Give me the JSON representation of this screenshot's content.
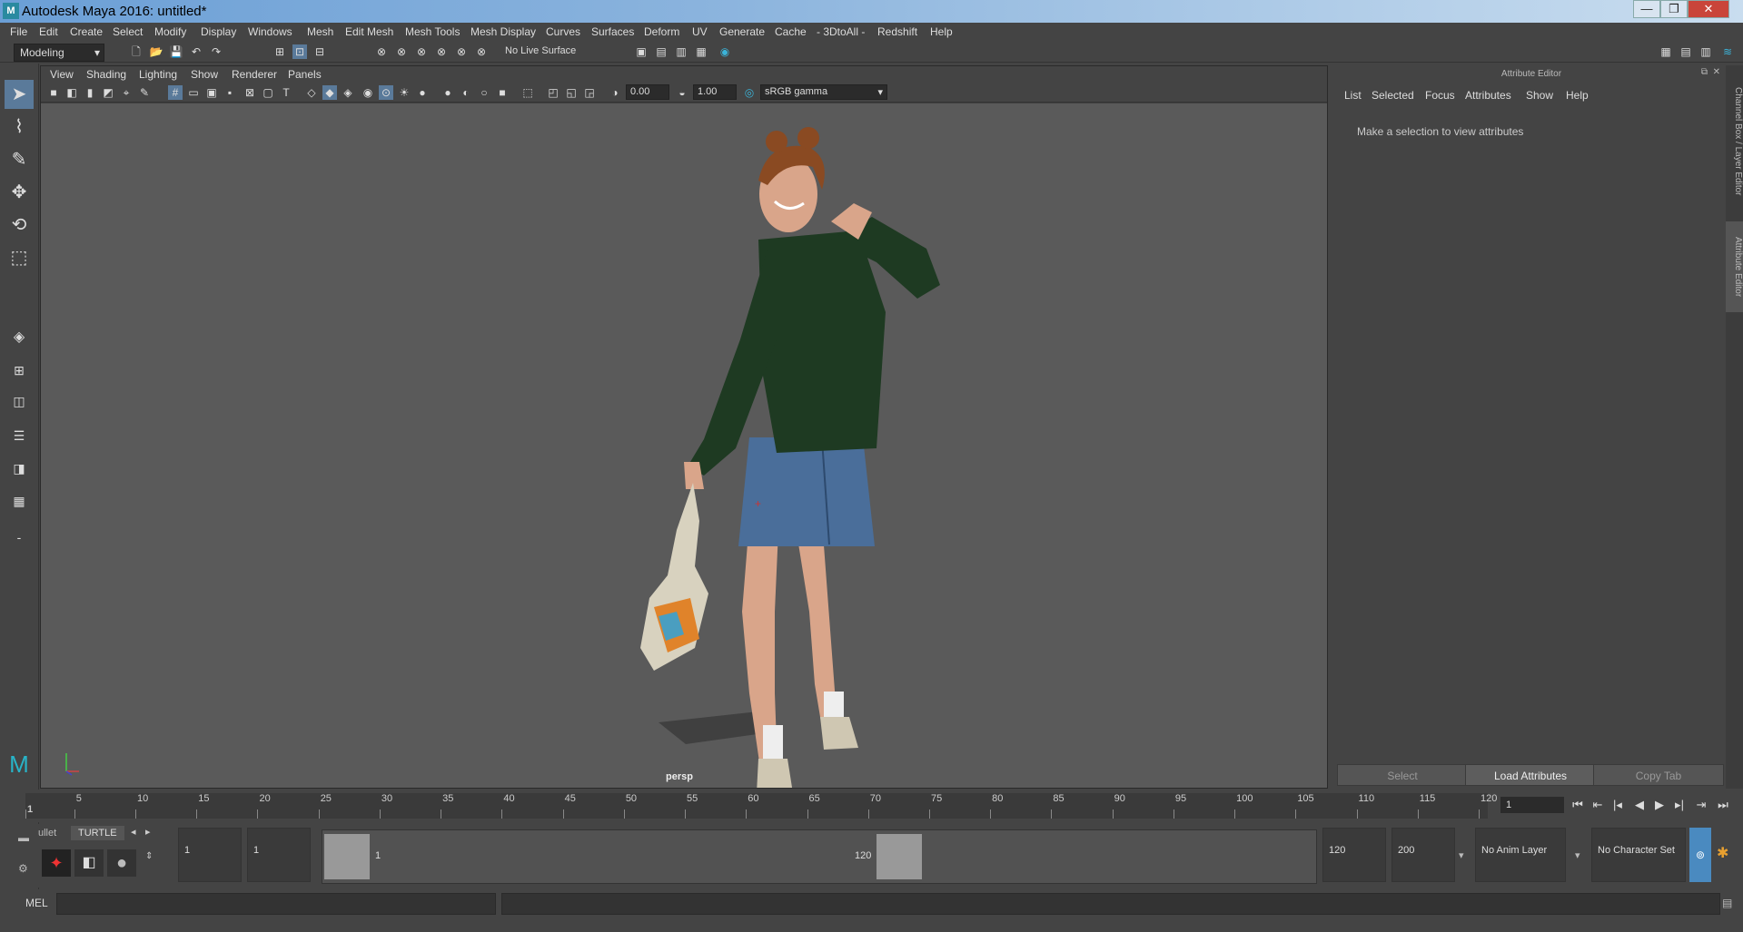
{
  "window": {
    "title": "Autodesk Maya 2016: untitled*",
    "app_icon": "M",
    "minimize": "—",
    "maximize": "❐",
    "close": "✕"
  },
  "menubar": [
    "File",
    "Edit",
    "Create",
    "Select",
    "Modify",
    "Display",
    "Windows",
    "Mesh",
    "Edit Mesh",
    "Mesh Tools",
    "Mesh Display",
    "Curves",
    "Surfaces",
    "Deform",
    "UV",
    "Generate",
    "Cache",
    "- 3DtoAll -",
    "Redshift",
    "Help"
  ],
  "statusline": {
    "mode": "Modeling",
    "live_surface": "No Live Surface"
  },
  "viewport": {
    "menu": [
      "View",
      "Shading",
      "Lighting",
      "Show",
      "Renderer",
      "Panels"
    ],
    "exposure": "0.00",
    "gamma": "1.00",
    "color_space": "sRGB gamma",
    "camera_label": "persp"
  },
  "attribute_editor": {
    "title": "Attribute Editor",
    "menu": [
      "List",
      "Selected",
      "Focus",
      "Attributes",
      "Show",
      "Help"
    ],
    "message": "Make a selection to view attributes",
    "buttons": {
      "select": "Select",
      "load": "Load Attributes",
      "copy": "Copy Tab"
    },
    "side_tabs": [
      "Channel Box / Layer Editor",
      "Attribute Editor"
    ]
  },
  "timeslider": {
    "ticks": [
      "1",
      "5",
      "10",
      "15",
      "20",
      "25",
      "30",
      "35",
      "40",
      "45",
      "50",
      "55",
      "60",
      "65",
      "70",
      "75",
      "80",
      "85",
      "90",
      "95",
      "100",
      "105",
      "110",
      "115",
      "120"
    ],
    "current_frame": "1"
  },
  "range": {
    "start_time": "1",
    "playback_start": "1",
    "range_start_label": "1",
    "range_end_label": "120",
    "playback_end": "120",
    "end_time": "200",
    "anim_layer": "No Anim Layer",
    "character_set": "No Character Set",
    "shelf_tabs": [
      "ullet",
      "TURTLE"
    ]
  },
  "cmdline": {
    "label": "MEL"
  }
}
